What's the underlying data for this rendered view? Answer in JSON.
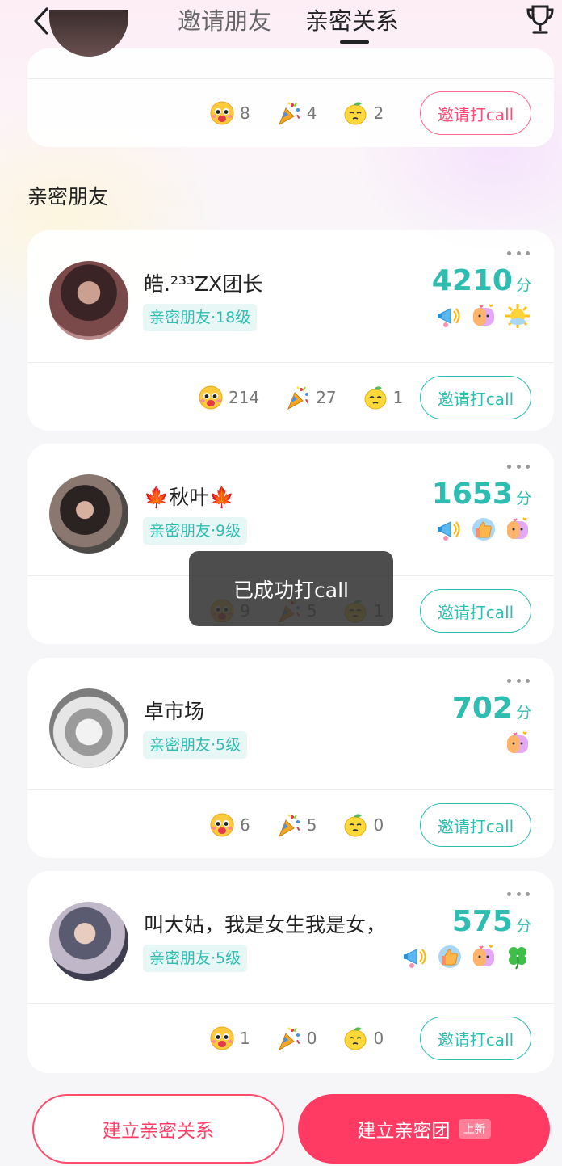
{
  "header": {
    "tabs": [
      {
        "label": "邀请朋友",
        "active": false
      },
      {
        "label": "亲密关系",
        "active": true
      }
    ]
  },
  "top_card": {
    "stats": [
      "8",
      "4",
      "2"
    ],
    "call_label": "邀请打call"
  },
  "section_title": "亲密朋友",
  "friends": [
    {
      "name": "皓.²³³ZX团长",
      "level": "亲密朋友·18级",
      "score": "4210",
      "score_unit": "分",
      "badges": [
        "megaphone-badge",
        "heart-bubble-badge",
        "sun-badge"
      ],
      "stats": [
        "214",
        "27",
        "1"
      ],
      "call_label": "邀请打call"
    },
    {
      "name": "🍁秋叶🍁",
      "level": "亲密朋友·9级",
      "score": "1653",
      "score_unit": "分",
      "badges": [
        "megaphone-badge",
        "thumbs-up-badge",
        "heart-bubble-badge"
      ],
      "stats": [
        "9",
        "5",
        "1"
      ],
      "call_label": "邀请打call"
    },
    {
      "name": "卓市场",
      "level": "亲密朋友·5级",
      "score": "702",
      "score_unit": "分",
      "badges": [
        "heart-bubble-badge"
      ],
      "stats": [
        "6",
        "5",
        "0"
      ],
      "call_label": "邀请打call"
    },
    {
      "name": "叫大姑，我是女生我是女，",
      "level": "亲密朋友·5级",
      "score": "575",
      "score_unit": "分",
      "badges": [
        "megaphone-badge",
        "thumbs-up-badge",
        "heart-bubble-badge",
        "clover-badge"
      ],
      "stats": [
        "1",
        "0",
        "0"
      ],
      "call_label": "邀请打call"
    }
  ],
  "toast": "已成功打call",
  "bottom": {
    "create_relation": "建立亲密关系",
    "create_group": "建立亲密团",
    "new_tag": "上新"
  },
  "colors": {
    "accent_teal": "#2fbcb1",
    "accent_pink": "#ff3b63"
  }
}
